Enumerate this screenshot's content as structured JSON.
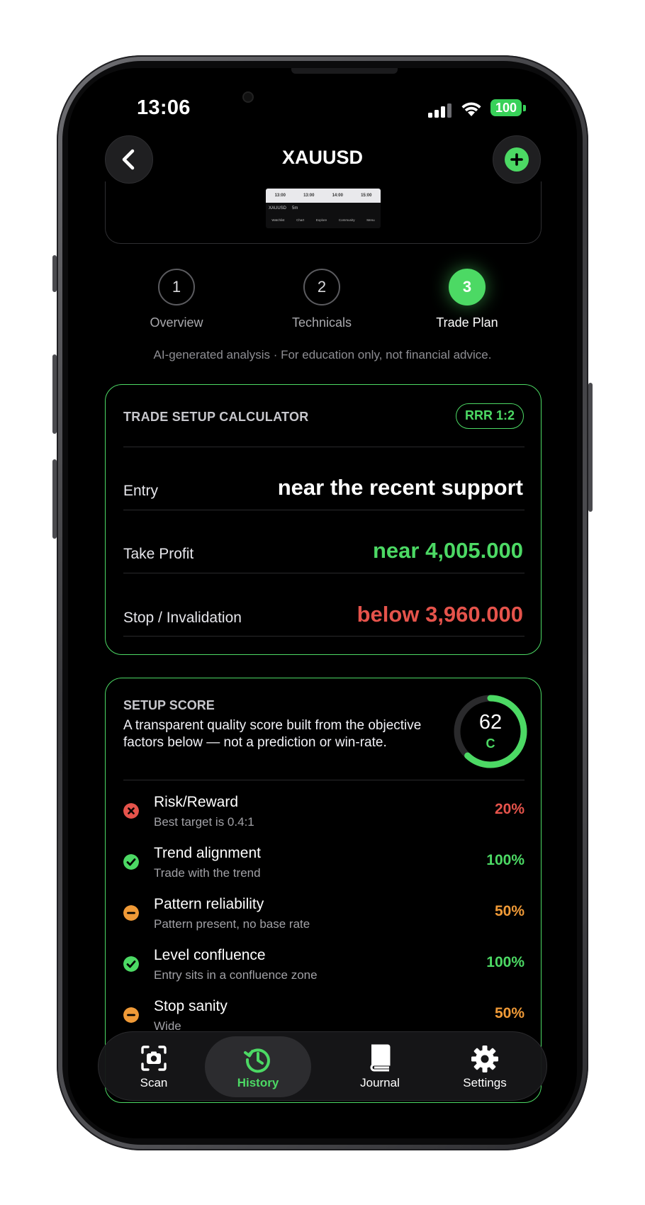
{
  "status_bar": {
    "time": "13:06",
    "battery": "100"
  },
  "nav": {
    "title": "XAUUSD",
    "back_icon": "chevron-left-icon",
    "add_icon": "plus-circle-icon"
  },
  "chart_thumb": {
    "times": [
      "13:00",
      "13:00",
      "14:00",
      "15:00"
    ],
    "symbol": "XAUUSD",
    "interval": "5m",
    "tabs": [
      "Watchlist",
      "Chart",
      "Explore",
      "Community",
      "Menu"
    ]
  },
  "steps": [
    {
      "num": "1",
      "label": "Overview",
      "active": false
    },
    {
      "num": "2",
      "label": "Technicals",
      "active": false
    },
    {
      "num": "3",
      "label": "Trade Plan",
      "active": true
    }
  ],
  "disclaimer": "AI-generated analysis · For education only, not financial advice.",
  "trade_setup": {
    "title": "TRADE SETUP CALCULATOR",
    "rrr": "RRR 1:2",
    "entry_label": "Entry",
    "entry_value": "near the recent support",
    "tp_label": "Take Profit",
    "tp_value": "near 4,005.000",
    "sl_label": "Stop / Invalidation",
    "sl_value": "below 3,960.000"
  },
  "setup_score": {
    "title": "SETUP SCORE",
    "description": "A transparent quality score built from the objective factors below — not a prediction or win-rate.",
    "score": "62",
    "score_value": 62,
    "grade": "C",
    "factors": [
      {
        "name": "Risk/Reward",
        "sub": "Best target is 0.4:1",
        "pct": "20%",
        "status": "fail"
      },
      {
        "name": "Trend alignment",
        "sub": "Trade with the trend",
        "pct": "100%",
        "status": "pass"
      },
      {
        "name": "Pattern reliability",
        "sub": "Pattern present, no base rate",
        "pct": "50%",
        "status": "partial"
      },
      {
        "name": "Level confluence",
        "sub": "Entry sits in a confluence zone",
        "pct": "100%",
        "status": "pass"
      },
      {
        "name": "Stop sanity",
        "sub": "Wide",
        "pct": "50%",
        "status": "partial"
      }
    ]
  },
  "tabbar": [
    {
      "label": "Scan",
      "icon": "camera-scan-icon",
      "active": false
    },
    {
      "label": "History",
      "icon": "history-clock-icon",
      "active": true
    },
    {
      "label": "Journal",
      "icon": "book-icon",
      "active": false
    },
    {
      "label": "Settings",
      "icon": "gear-icon",
      "active": false
    }
  ],
  "colors": {
    "green": "#4cd964",
    "red": "#e5534b",
    "orange": "#f09a37"
  }
}
